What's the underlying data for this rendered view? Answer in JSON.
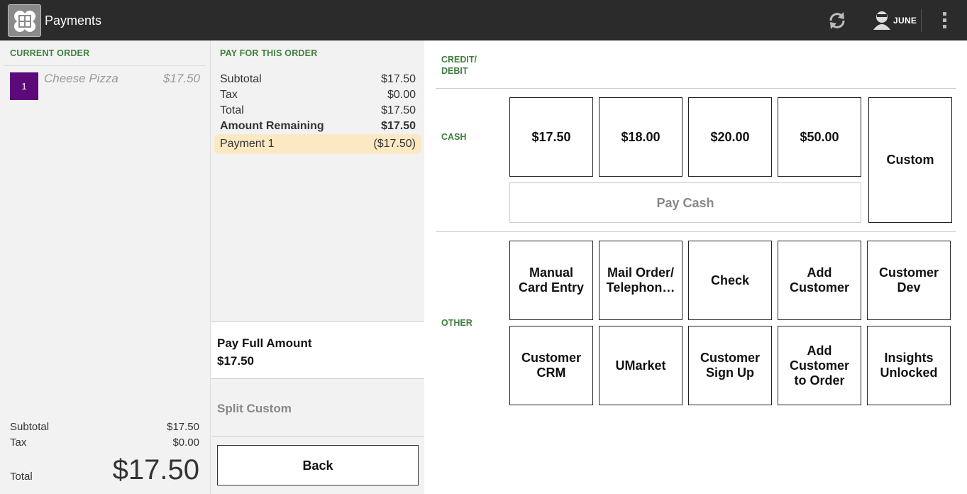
{
  "header": {
    "app_title": "Payments",
    "user_name": "JUNE",
    "icons": [
      "app-logo-icon",
      "refresh-icon",
      "user-icon",
      "more-vert-icon"
    ]
  },
  "current_order": {
    "heading": "CURRENT ORDER",
    "items": [
      {
        "qty": "1",
        "name": "Cheese Pizza",
        "price": "$17.50"
      }
    ],
    "subtotal_label": "Subtotal",
    "subtotal_value": "$17.50",
    "tax_label": "Tax",
    "tax_value": "$0.00",
    "total_label": "Total",
    "total_value": "$17.50"
  },
  "pay_for_order": {
    "heading": "PAY FOR THIS ORDER",
    "rows": [
      {
        "label": "Subtotal",
        "value": "$17.50"
      },
      {
        "label": "Tax",
        "value": "$0.00"
      },
      {
        "label": "Total",
        "value": "$17.50"
      },
      {
        "label": "Amount Remaining",
        "value": "$17.50"
      }
    ],
    "payment": {
      "label": "Payment 1",
      "value": "($17.50)"
    },
    "pay_full_label": "Pay Full Amount",
    "pay_full_amount": "$17.50",
    "split_custom_label": "Split Custom",
    "back_label": "Back"
  },
  "tenders": {
    "credit_heading": "CREDIT/\nDEBIT",
    "cash_heading": "CASH",
    "other_heading": "OTHER",
    "cash_amounts": [
      "$17.50",
      "$18.00",
      "$20.00",
      "$50.00"
    ],
    "custom_label": "Custom",
    "pay_cash_label": "Pay Cash",
    "other_buttons": [
      "Manual Card Entry",
      "Mail Order/ Telephon…",
      "Check",
      "Add Customer",
      "Customer Dev",
      "Customer CRM",
      "UMarket",
      "Customer Sign Up",
      "Add Customer to Order",
      "Insights Unlocked"
    ]
  },
  "colors": {
    "topbar": "#2b2b2b",
    "section_heading": "#3f7f3f",
    "qty_badge": "#5c0a7a",
    "payment_highlight": "#fde8c4"
  }
}
